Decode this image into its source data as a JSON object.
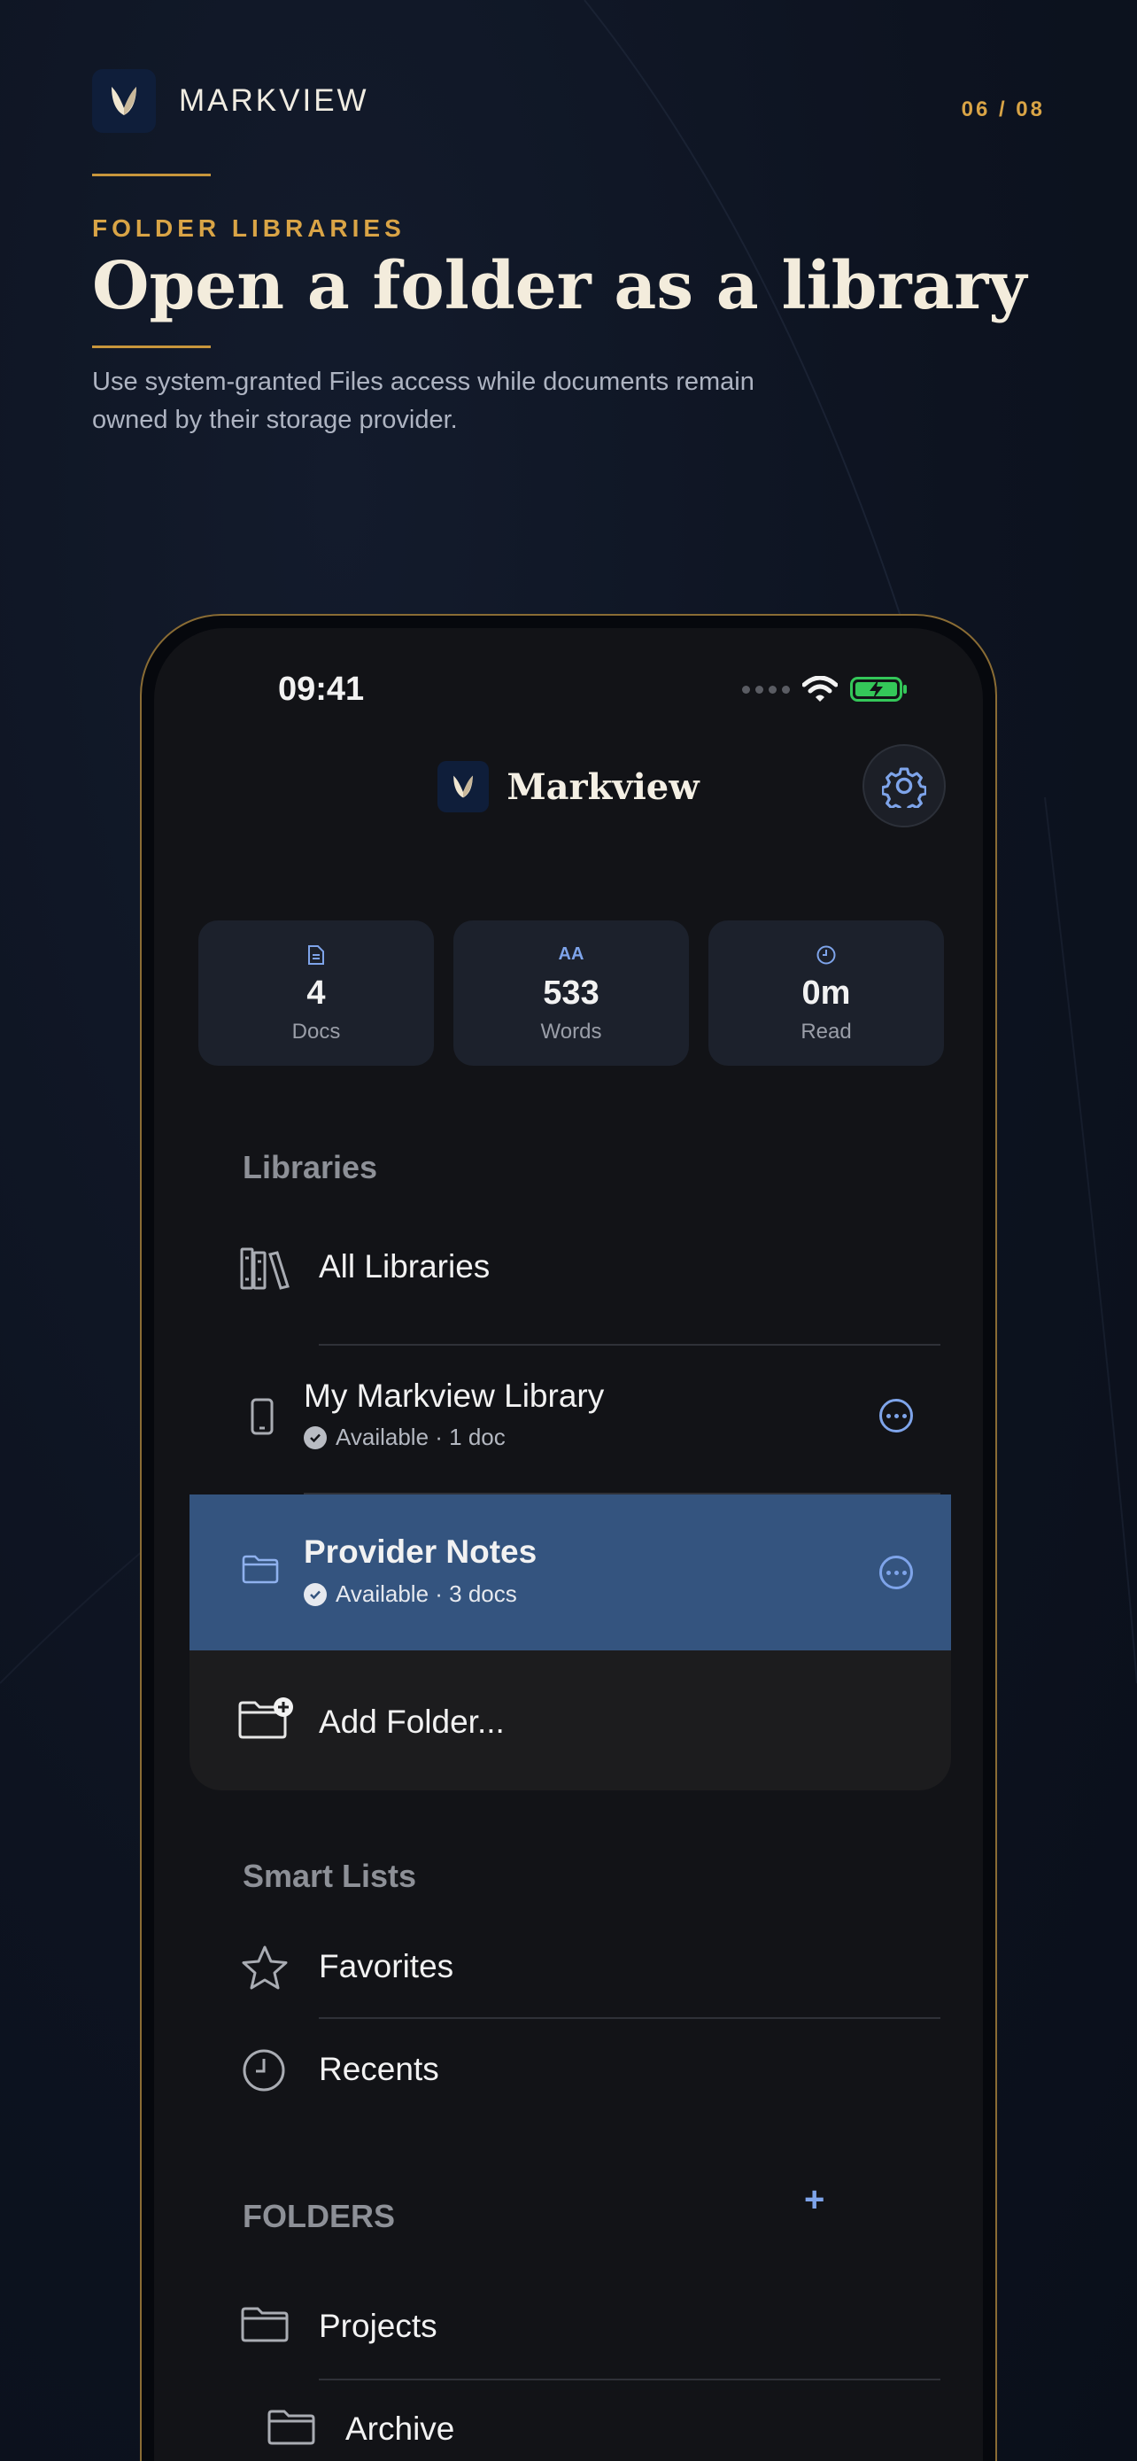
{
  "brand": {
    "name": "MARKVIEW",
    "pager": "06 / 08"
  },
  "hero": {
    "eyebrow": "FOLDER LIBRARIES",
    "title": "Open a folder as a library",
    "subtitle": "Use system-granted Files access while documents remain owned by their storage provider."
  },
  "status_bar": {
    "time": "09:41"
  },
  "app": {
    "name": "Markview",
    "settings_icon": "gear-icon"
  },
  "stats": [
    {
      "icon": "document-icon",
      "value": "4",
      "label": "Docs"
    },
    {
      "icon": "text-size-icon",
      "icon_text": "AA",
      "value": "533",
      "label": "Words"
    },
    {
      "icon": "clock-icon",
      "value": "0m",
      "label": "Read"
    }
  ],
  "libraries": {
    "title": "Libraries",
    "all": "All Libraries",
    "items": [
      {
        "name": "My Markview Library",
        "status": "Available · 1 doc",
        "selected": false
      },
      {
        "name": "Provider Notes",
        "status": "Available · 3 docs",
        "selected": true
      }
    ],
    "add_folder": "Add Folder..."
  },
  "smart_lists": {
    "title": "Smart Lists",
    "items": [
      {
        "label": "Favorites"
      },
      {
        "label": "Recents"
      }
    ]
  },
  "folders": {
    "title": "FOLDERS",
    "add_label": "+",
    "items": [
      {
        "label": "Projects"
      },
      {
        "label": "Archive"
      }
    ]
  },
  "colors": {
    "accent_gold": "#d9a446",
    "accent_blue": "#7ea4ea",
    "selected_row": "#34547f",
    "battery_green": "#34c759"
  }
}
